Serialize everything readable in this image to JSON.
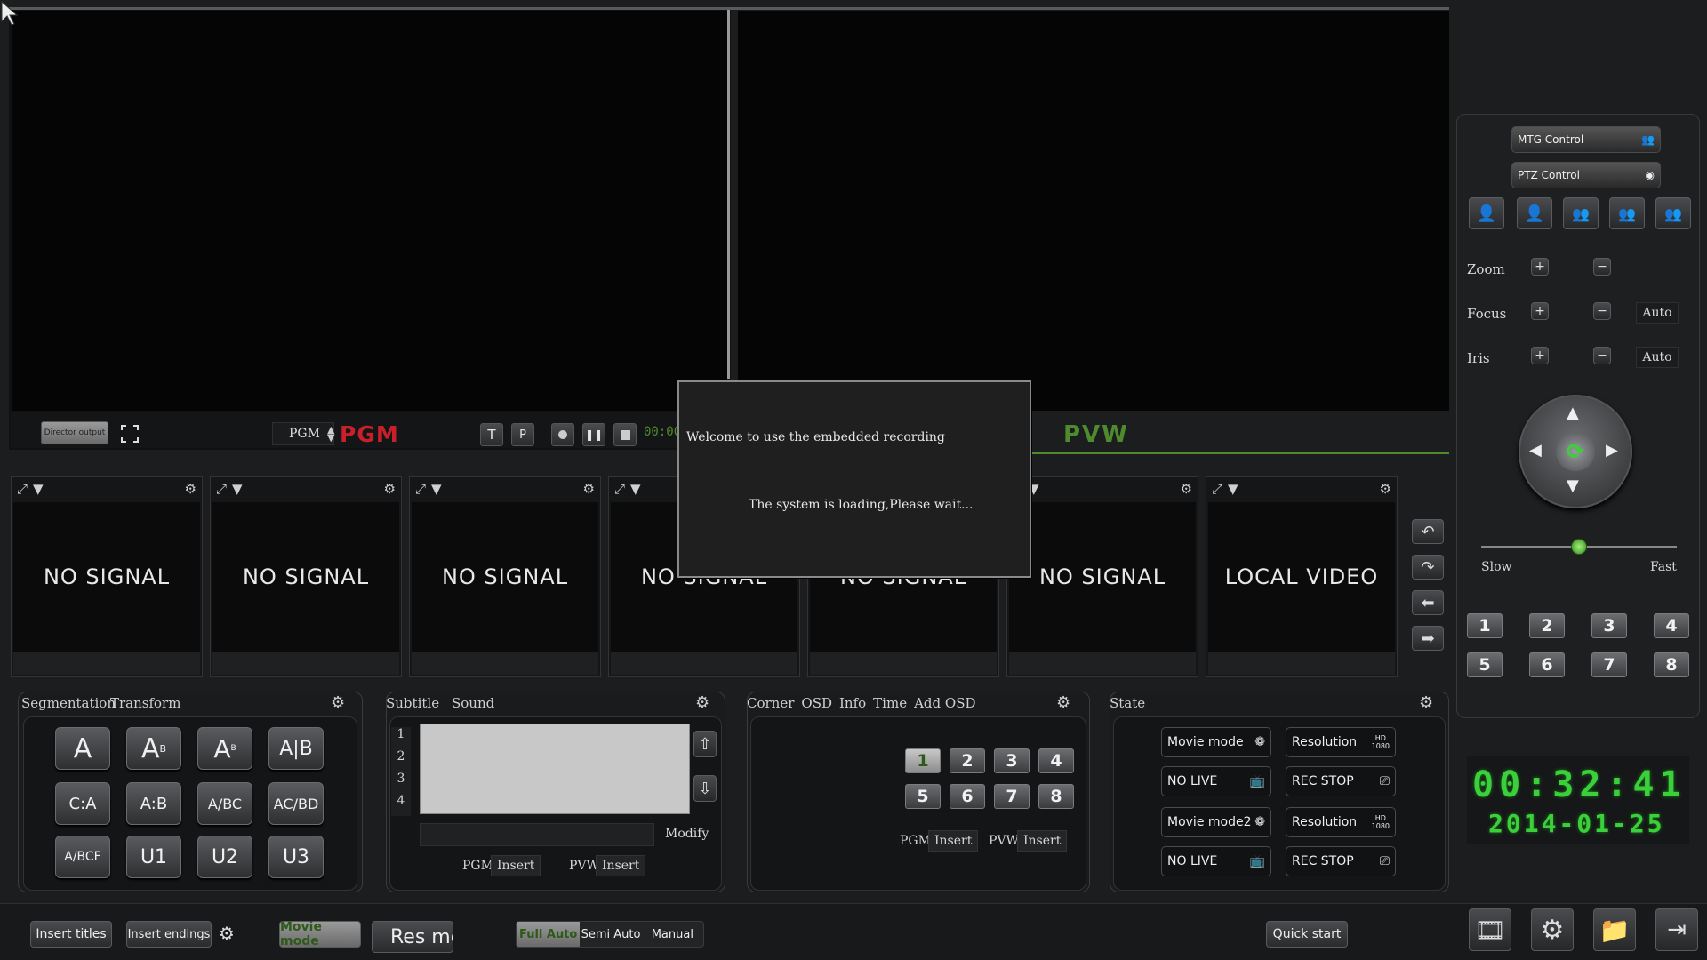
{
  "colors": {
    "pgm_red": "#c8202a",
    "pvw_green": "#4f8b2e",
    "clock_green": "#3bd03b",
    "background": "#1c1d1f"
  },
  "pgm_bar": {
    "director_output": "Director output",
    "pgm_select": "PGM",
    "pgm_label": "PGM",
    "timer": "00:00"
  },
  "pvw_label": "PVW",
  "sources": [
    {
      "label": "NO SIGNAL"
    },
    {
      "label": "NO SIGNAL"
    },
    {
      "label": "NO SIGNAL"
    },
    {
      "label": "NO SIGNAL"
    },
    {
      "label": "NO SIGNAL"
    },
    {
      "label": "NO SIGNAL"
    },
    {
      "label": "LOCAL VIDEO"
    }
  ],
  "segmentation_panel": {
    "tab1": "Segmentation",
    "tab2": "Transform",
    "user_layouts": [
      "U1",
      "U2",
      "U3"
    ]
  },
  "subtitle_panel": {
    "tab1": "Subtitle",
    "tab2": "Sound",
    "rows": [
      "1",
      "2",
      "3",
      "4"
    ],
    "modify": "Modify",
    "pgm": "PGM",
    "pvw": "PVW",
    "insert": "Insert"
  },
  "osd_panel": {
    "tabs": [
      "Corner",
      "OSD",
      "Info",
      "Time",
      "Add",
      "OSD"
    ],
    "keys": [
      "1",
      "2",
      "3",
      "4",
      "5",
      "6",
      "7",
      "8"
    ],
    "pgm": "PGM",
    "pvw": "PVW",
    "insert": "Insert"
  },
  "state_panel": {
    "tab": "State",
    "left_buttons": [
      "Movie mode",
      "NO LIVE",
      "Movie mode2",
      "NO LIVE"
    ],
    "right_buttons": [
      "Resolution",
      "REC STOP",
      "Resolution",
      "REC STOP"
    ],
    "hd_badge": "HD",
    "hd_res": "1080"
  },
  "dialog": {
    "line1": "Welcome to use the embedded recording",
    "line2": "The system is loading,Please wait..."
  },
  "ptz_panel": {
    "mtg_control": "MTG Control",
    "ptz_control": "PTZ Control",
    "zoom": "Zoom",
    "focus": "Focus",
    "iris": "Iris",
    "auto": "Auto",
    "slow": "Slow",
    "fast": "Fast",
    "speed_fraction": 0.5,
    "presets": [
      "1",
      "2",
      "3",
      "4",
      "5",
      "6",
      "7",
      "8"
    ]
  },
  "clock": {
    "time": "00:32:41",
    "date": "2014-01-25"
  },
  "bottom_bar": {
    "insert_titles": "Insert titles",
    "insert_endings": "Insert endings",
    "movie_mode": "Movie mode",
    "res_mode": "Res mo",
    "full_auto": "Full Auto",
    "semi_auto": "Semi Auto",
    "manual": "Manual",
    "quick_start": "Quick start"
  }
}
